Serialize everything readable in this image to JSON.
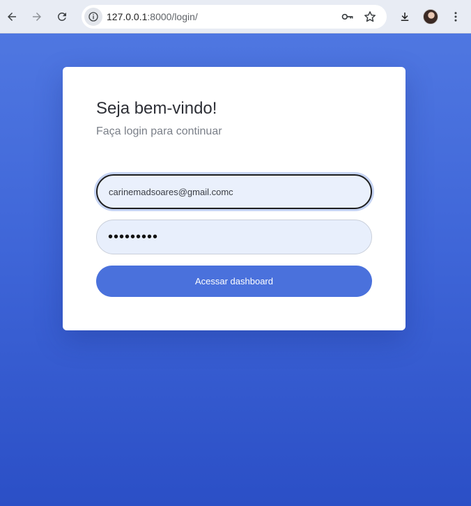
{
  "browser": {
    "url_host": "127.0.0.1",
    "url_path": ":8000/login/",
    "icons": [
      "back-icon",
      "forward-icon",
      "reload-icon",
      "site-info-icon",
      "password-key-icon",
      "bookmark-star-icon",
      "download-icon",
      "profile-avatar",
      "menu-icon"
    ]
  },
  "login": {
    "title": "Seja bem-vindo!",
    "subtitle": "Faça login para continuar",
    "email_value": "carinemadsoares@gmail.comc",
    "password_value": "carine123",
    "submit_label": "Acessar dashboard"
  },
  "colors": {
    "accent": "#4a71dc",
    "background_top": "#4f77e1",
    "background_bottom": "#2b4fc6",
    "input_bg": "#eaf0fc"
  }
}
